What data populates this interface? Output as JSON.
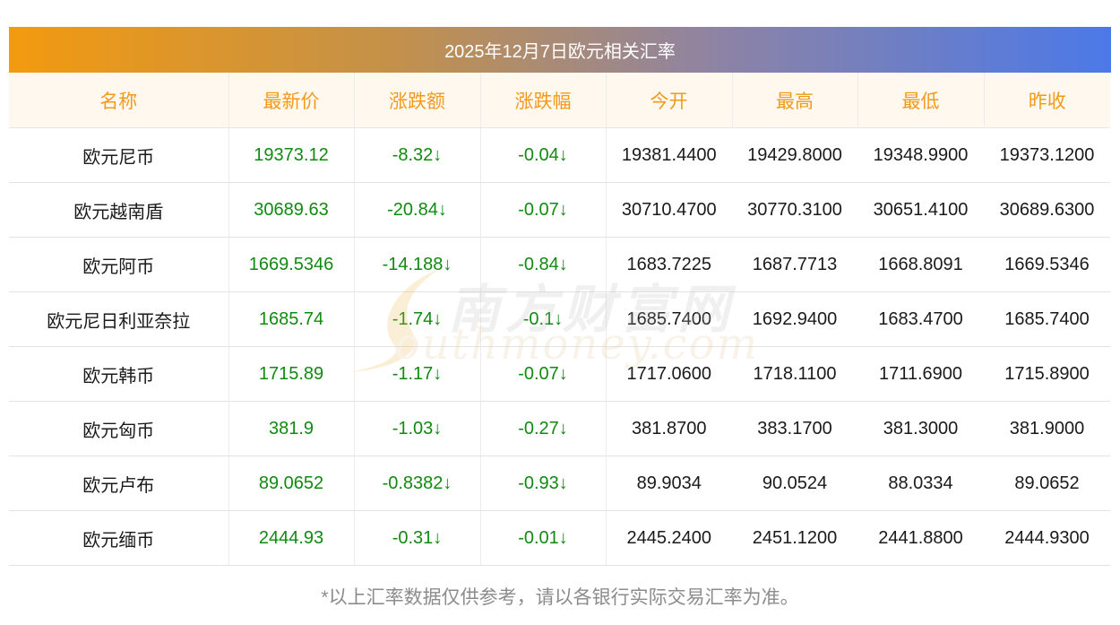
{
  "title": "2025年12月7日欧元相关汇率",
  "headers": [
    "名称",
    "最新价",
    "涨跌额",
    "涨跌幅",
    "今开",
    "最高",
    "最低",
    "昨收"
  ],
  "rows": [
    {
      "name": "欧元尼币",
      "latest": "19373.12",
      "change": "-8.32↓",
      "pct": "-0.04↓",
      "open": "19381.4400",
      "high": "19429.8000",
      "low": "19348.9900",
      "prev": "19373.1200"
    },
    {
      "name": "欧元越南盾",
      "latest": "30689.63",
      "change": "-20.84↓",
      "pct": "-0.07↓",
      "open": "30710.4700",
      "high": "30770.3100",
      "low": "30651.4100",
      "prev": "30689.6300"
    },
    {
      "name": "欧元阿币",
      "latest": "1669.5346",
      "change": "-14.188↓",
      "pct": "-0.84↓",
      "open": "1683.7225",
      "high": "1687.7713",
      "low": "1668.8091",
      "prev": "1669.5346"
    },
    {
      "name": "欧元尼日利亚奈拉",
      "latest": "1685.74",
      "change": "-1.74↓",
      "pct": "-0.1↓",
      "open": "1685.7400",
      "high": "1692.9400",
      "low": "1683.4700",
      "prev": "1685.7400"
    },
    {
      "name": "欧元韩币",
      "latest": "1715.89",
      "change": "-1.17↓",
      "pct": "-0.07↓",
      "open": "1717.0600",
      "high": "1718.1100",
      "low": "1711.6900",
      "prev": "1715.8900"
    },
    {
      "name": "欧元匈币",
      "latest": "381.9",
      "change": "-1.03↓",
      "pct": "-0.27↓",
      "open": "381.8700",
      "high": "383.1700",
      "low": "381.3000",
      "prev": "381.9000"
    },
    {
      "name": "欧元卢布",
      "latest": "89.0652",
      "change": "-0.8382↓",
      "pct": "-0.93↓",
      "open": "89.9034",
      "high": "90.0524",
      "low": "88.0334",
      "prev": "89.0652"
    },
    {
      "name": "欧元缅币",
      "latest": "2444.93",
      "change": "-0.31↓",
      "pct": "-0.01↓",
      "open": "2445.2400",
      "high": "2451.1200",
      "low": "2441.8800",
      "prev": "2444.9300"
    }
  ],
  "note": "*以上汇率数据仅供参考，请以各银行实际交易汇率为准。",
  "watermark": {
    "cn": "南方财富网",
    "en": "outhmoney.com"
  },
  "colors": {
    "header_text": "#f39a1a",
    "change_text": "#118a11",
    "banner_start": "#f39a0f",
    "banner_end": "#4b79e8"
  }
}
